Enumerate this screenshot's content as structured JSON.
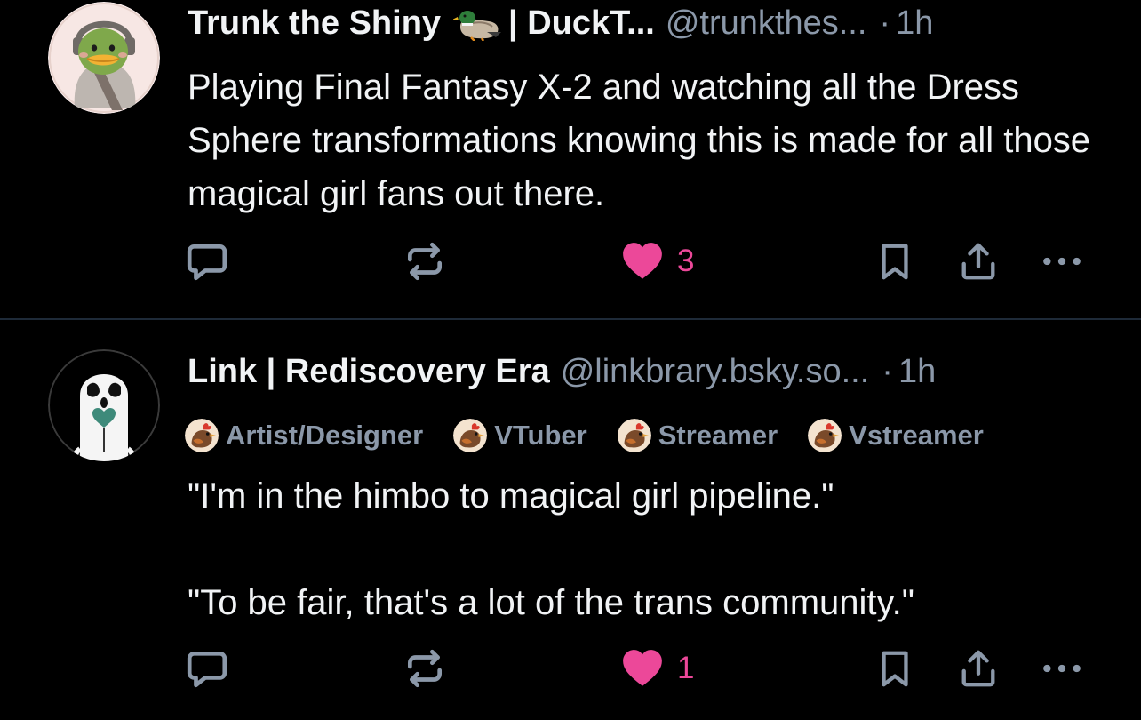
{
  "colors": {
    "background": "#000000",
    "text_primary": "#f1f3f5",
    "text_secondary": "#8b98a9",
    "divider": "#1e2a38",
    "like": "#ec4899"
  },
  "posts": [
    {
      "avatar_icon": "duck-avatar",
      "display_name_before_emoji": "Trunk the Shiny",
      "display_name_emoji": "duck-emoji",
      "display_name_after_emoji": "| DuckT...",
      "handle": "@trunkthes...",
      "separator": "·",
      "time": "1h",
      "text": [
        "Playing Final Fantasy X-2 and watching all the Dress Sphere transformations knowing this is made for all those magical girl fans out there."
      ],
      "actions": {
        "reply_icon": "reply-icon",
        "repost_icon": "repost-icon",
        "like_icon": "heart-filled-icon",
        "like_count": "3",
        "bookmark_icon": "bookmark-icon",
        "share_icon": "share-icon",
        "more_icon": "more-icon"
      }
    },
    {
      "avatar_icon": "ghost-avatar",
      "display_name": "Link | Rediscovery Era",
      "handle": "@linkbrary.bsky.so...",
      "separator": "·",
      "time": "1h",
      "labels": [
        {
          "icon": "rooster-label-icon",
          "text": "Artist/Designer"
        },
        {
          "icon": "rooster-label-icon",
          "text": "VTuber"
        },
        {
          "icon": "rooster-label-icon",
          "text": "Streamer"
        },
        {
          "icon": "rooster-label-icon",
          "text": "Vstreamer"
        }
      ],
      "text": [
        "\"I'm in the himbo to magical girl pipeline.\"",
        "\"To be fair, that's a lot of the trans community.\""
      ],
      "actions": {
        "reply_icon": "reply-icon",
        "repost_icon": "repost-icon",
        "like_icon": "heart-filled-icon",
        "like_count": "1",
        "bookmark_icon": "bookmark-icon",
        "share_icon": "share-icon",
        "more_icon": "more-icon"
      }
    }
  ]
}
